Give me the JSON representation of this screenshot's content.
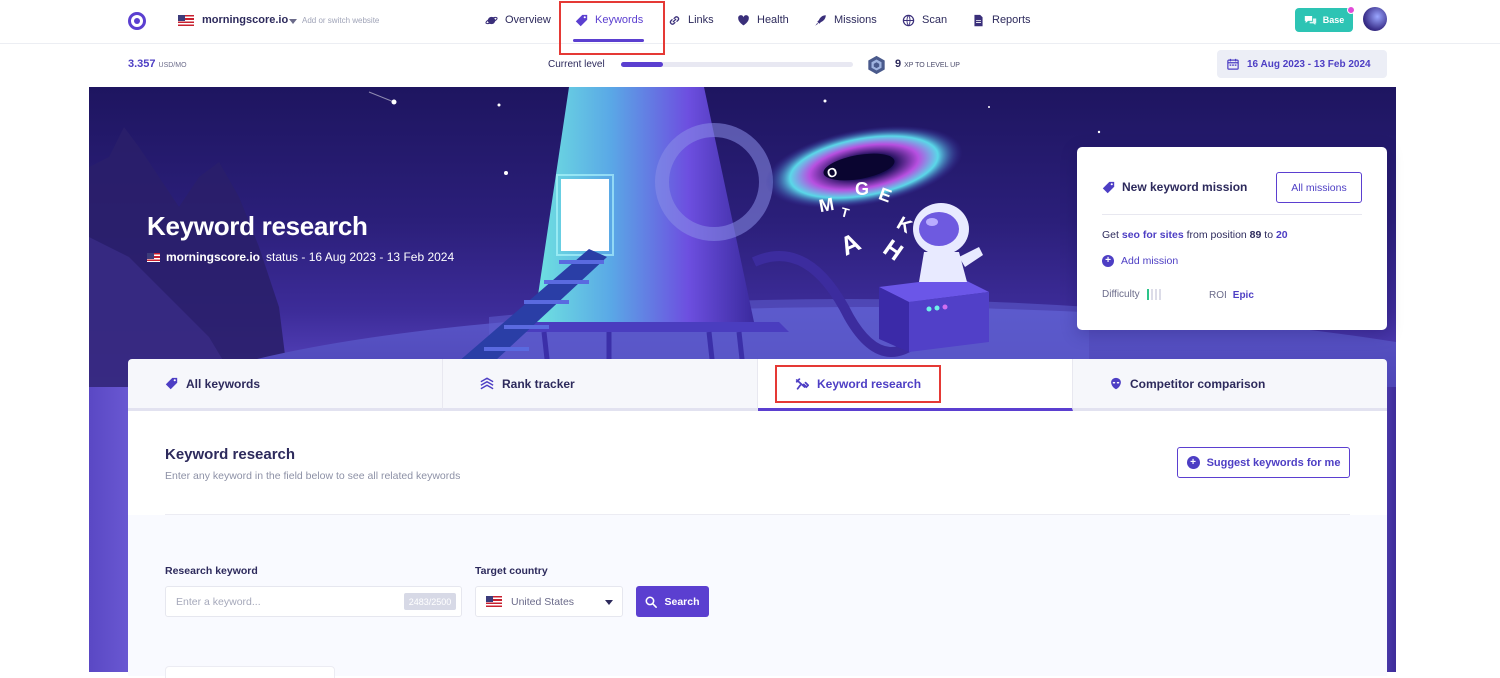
{
  "header": {
    "site_name": "morningscore.io",
    "switch_hint": "Add or switch website",
    "nav": [
      {
        "label": "Overview",
        "icon": "planet-icon"
      },
      {
        "label": "Keywords",
        "icon": "tag-icon",
        "active": true
      },
      {
        "label": "Links",
        "icon": "link-icon"
      },
      {
        "label": "Health",
        "icon": "heart-icon"
      },
      {
        "label": "Missions",
        "icon": "rocket-icon"
      },
      {
        "label": "Scan",
        "icon": "globe-icon"
      },
      {
        "label": "Reports",
        "icon": "document-icon"
      }
    ],
    "base_label": "Base"
  },
  "stats": {
    "usd_value": "3.357",
    "usd_unit": "USD/MO",
    "current_level_label": "Current level",
    "level_progress": 0.18,
    "xp_value": "9",
    "xp_label": "XP TO LEVEL UP",
    "date_range": "16 Aug 2023 - 13 Feb 2024"
  },
  "hero": {
    "title": "Keyword research",
    "site": "morningscore.io",
    "status_text": "status - 16 Aug 2023 - 13 Feb 2024",
    "floating_letters": [
      "O",
      "M",
      "T",
      "G",
      "E",
      "K",
      "A",
      "H"
    ]
  },
  "mission_card": {
    "title": "New keyword mission",
    "all_missions_label": "All missions",
    "line_prefix": "Get",
    "keyword": "seo for sites",
    "line_mid": "from position",
    "from_position": "89",
    "to_word": "to",
    "to_position": "20",
    "add_mission_label": "Add mission",
    "difficulty_label": "Difficulty",
    "difficulty_level": 1,
    "difficulty_max": 4,
    "roi_label": "ROI",
    "roi_value": "Epic"
  },
  "tabs": [
    {
      "label": "All keywords",
      "icon": "tag-icon"
    },
    {
      "label": "Rank tracker",
      "icon": "layers-icon"
    },
    {
      "label": "Keyword research",
      "icon": "telescope-icon",
      "active": true
    },
    {
      "label": "Competitor comparison",
      "icon": "alien-icon"
    }
  ],
  "research": {
    "title": "Keyword research",
    "description": "Enter any keyword in the field below to see all related keywords",
    "suggest_label": "Suggest keywords for me",
    "keyword_label": "Research keyword",
    "keyword_placeholder": "Enter a keyword...",
    "keyword_value": "",
    "counter": "2483/2500",
    "country_label": "Target country",
    "country_value": "United States",
    "search_label": "Search"
  },
  "colors": {
    "accent": "#5b3fd0",
    "base_button": "#2dc4b4",
    "highlight_box": "#e53935",
    "hero_dark": "#1e1560"
  }
}
